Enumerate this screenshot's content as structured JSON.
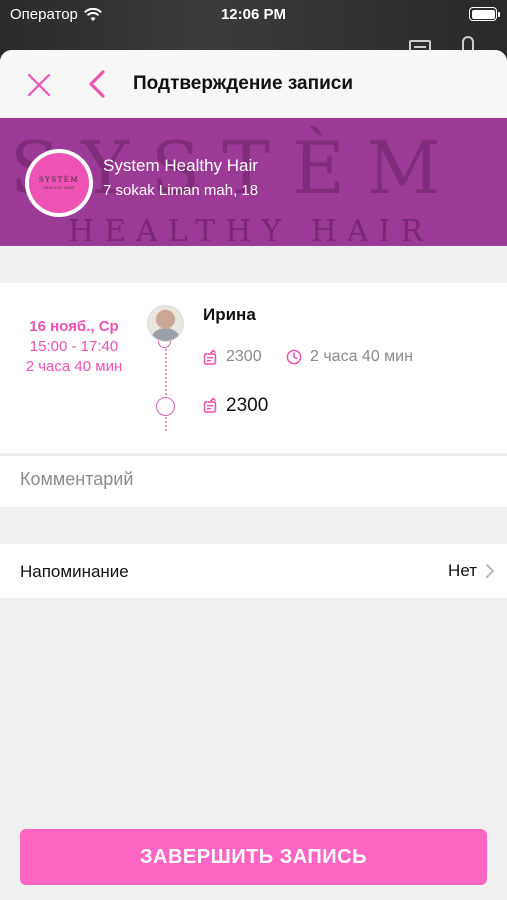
{
  "status_bar": {
    "carrier": "Оператор",
    "time": "12:06 PM"
  },
  "nav": {
    "title": "Подтверждение записи",
    "close_icon": "close-icon",
    "back_icon": "chevron-left-icon"
  },
  "salon": {
    "name": "System Healthy Hair",
    "address": "7 sokak Liman mah, 18",
    "logo_text": "SYSTÈM",
    "logo_subtext": "HEALTHY HAIR",
    "banner_text_1": "SYSTÈM",
    "banner_text_2": "HEALTHY HAIR"
  },
  "appointment": {
    "date": "16 нояб., Ср",
    "time_range": "15:00 - 17:40",
    "duration": "2 часа 40 мин",
    "master_name": "Ирина",
    "service_price": "2300",
    "service_duration": "2 часа 40 мин",
    "total_price": "2300"
  },
  "comment": {
    "placeholder": "Комментарий"
  },
  "reminder": {
    "label": "Напоминание",
    "value": "Нет"
  },
  "actions": {
    "finish_label": "ЗАВЕРШИТЬ ЗАПИСЬ"
  },
  "colors": {
    "accent": "#ff66c4",
    "accent_text": "#ee52b4",
    "banner": "#9c3a97",
    "background": "#f0f0f0"
  }
}
